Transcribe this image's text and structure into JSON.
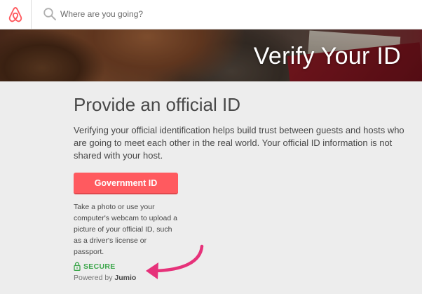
{
  "nav": {
    "logo_icon": "airbnb-logo-icon",
    "search_icon": "search-icon",
    "search_placeholder": "Where are you going?"
  },
  "hero": {
    "title": "Verify Your ID"
  },
  "main": {
    "heading": "Provide an official ID",
    "intro": "Verifying your official identification helps build trust between guests and hosts who are going to meet each other in the real world. Your official ID information is not shared with your host.",
    "government_button": "Government ID",
    "help_text": "Take a photo or use your computer's webcam to upload a picture of your official ID, such as a driver's license or passport.",
    "secure_icon": "lock-icon",
    "secure_label": "SECURE",
    "powered_prefix": "Powered by",
    "powered_brand": "Jumio"
  },
  "colors": {
    "brand": "#ff5a5f",
    "secure_green": "#3ba64a",
    "annotation_arrow": "#e6327a"
  }
}
